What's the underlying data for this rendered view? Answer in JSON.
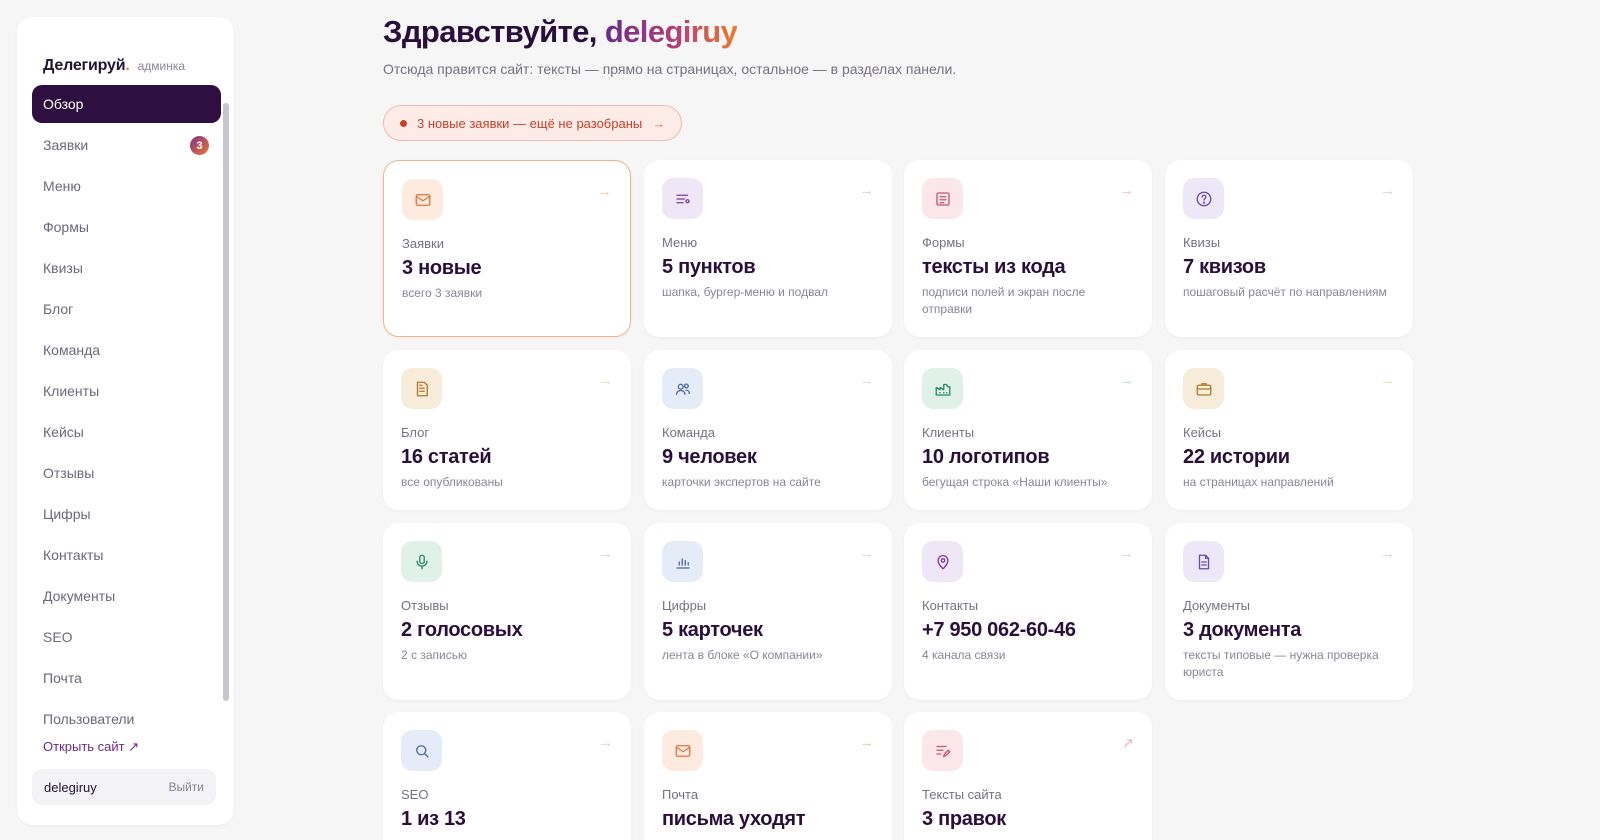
{
  "sidebar": {
    "brand": "Делегируй",
    "brand_dot": ".",
    "brand_sub": "админка",
    "items": [
      {
        "label": "Обзор"
      },
      {
        "label": "Заявки",
        "badge": "3"
      },
      {
        "label": "Меню"
      },
      {
        "label": "Формы"
      },
      {
        "label": "Квизы"
      },
      {
        "label": "Блог"
      },
      {
        "label": "Команда"
      },
      {
        "label": "Клиенты"
      },
      {
        "label": "Кейсы"
      },
      {
        "label": "Отзывы"
      },
      {
        "label": "Цифры"
      },
      {
        "label": "Контакты"
      },
      {
        "label": "Документы"
      },
      {
        "label": "SEO"
      },
      {
        "label": "Почта"
      },
      {
        "label": "Пользователи"
      }
    ],
    "open_site": "Открыть сайт ↗",
    "user": "delegiruy",
    "logout": "Выйти"
  },
  "header": {
    "greeting": "Здравствуйте, ",
    "brand_word": "delegiruy",
    "subtitle": "Отсюда правится сайт: тексты — прямо на страницах, остальное — в разделах панели."
  },
  "alert": {
    "text": "3 новые заявки — ещё не разобраны",
    "arrow": "→"
  },
  "cards": [
    {
      "label": "Заявки",
      "value": "3 новые",
      "note": "всего 3 заявки",
      "icon": "mail-icon",
      "arrow": "→"
    },
    {
      "label": "Меню",
      "value": "5 пунктов",
      "note": "шапка, бургер-меню и подвал",
      "icon": "menu-list-icon",
      "arrow": "→"
    },
    {
      "label": "Формы",
      "value": "тексты из кода",
      "note": "подписи полей и экран после отправки",
      "icon": "form-icon",
      "arrow": "→"
    },
    {
      "label": "Квизы",
      "value": "7 квизов",
      "note": "пошаговый расчёт по направлениям",
      "icon": "question-icon",
      "arrow": "→"
    },
    {
      "label": "Блог",
      "value": "16 статей",
      "note": "все опубликованы",
      "icon": "document-icon",
      "arrow": "→"
    },
    {
      "label": "Команда",
      "value": "9 человек",
      "note": "карточки экспертов на сайте",
      "icon": "users-icon",
      "arrow": "→"
    },
    {
      "label": "Клиенты",
      "value": "10 логотипов",
      "note": "бегущая строка «Наши клиенты»",
      "icon": "factory-icon",
      "arrow": "→"
    },
    {
      "label": "Кейсы",
      "value": "22 истории",
      "note": "на страницах направлений",
      "icon": "briefcase-icon",
      "arrow": "→"
    },
    {
      "label": "Отзывы",
      "value": "2 голосовых",
      "note": "2 с записью",
      "icon": "microphone-icon",
      "arrow": "→"
    },
    {
      "label": "Цифры",
      "value": "5 карточек",
      "note": "лента в блоке «О компании»",
      "icon": "bar-chart-icon",
      "arrow": "→"
    },
    {
      "label": "Контакты",
      "value": "+7 950 062-60-46",
      "note": "4 канала связи",
      "icon": "map-pin-icon",
      "arrow": "→"
    },
    {
      "label": "Документы",
      "value": "3 документа",
      "note": "тексты типовые — нужна проверка юриста",
      "icon": "file-icon",
      "arrow": "→"
    },
    {
      "label": "SEO",
      "value": "1 из 13",
      "note": "",
      "icon": "search-icon",
      "arrow": "→"
    },
    {
      "label": "Почта",
      "value": "письма уходят",
      "note": "",
      "icon": "mail-icon",
      "arrow": "→"
    },
    {
      "label": "Тексты сайта",
      "value": "3 правок",
      "note": "",
      "icon": "edit-text-icon",
      "arrow": "↗"
    }
  ],
  "colors": {
    "accent_dark": "#2e0f40",
    "accent_orange": "#f07a2a",
    "alert_red": "#c2432a"
  }
}
